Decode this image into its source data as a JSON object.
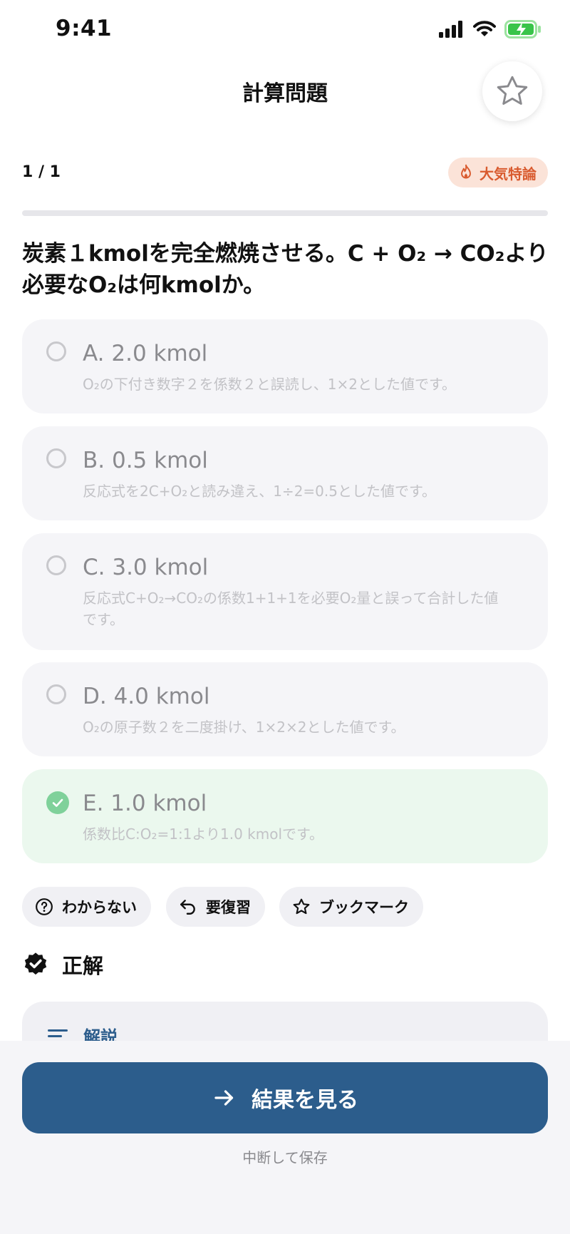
{
  "status_bar": {
    "time": "9:41"
  },
  "header": {
    "title": "計算問題"
  },
  "meta": {
    "counter": "1 / 1",
    "tag": "大気特論"
  },
  "question": {
    "text": "炭素１kmolを完全燃焼させる。C + O₂ → CO₂より必要なO₂は何kmolか。"
  },
  "choices": [
    {
      "label": "A. 2.0 kmol",
      "explanation": "O₂の下付き数字２を係数２と誤読し、1×2とした値です。",
      "state": "unselected"
    },
    {
      "label": "B. 0.5 kmol",
      "explanation": "反応式を2C+O₂と読み違え、1÷2=0.5とした値です。",
      "state": "unselected"
    },
    {
      "label": "C. 3.0 kmol",
      "explanation": "反応式C+O₂→CO₂の係数1+1+1を必要O₂量と誤って合計した値です。",
      "state": "unselected"
    },
    {
      "label": "D. 4.0 kmol",
      "explanation": "O₂の原子数２を二度掛け、1×2×2とした値です。",
      "state": "unselected"
    },
    {
      "label": "E. 1.0 kmol",
      "explanation": "係数比C:O₂=1:1より1.0 kmolです。",
      "state": "correct"
    }
  ],
  "actions": {
    "dont_know": "わからない",
    "review": "要復習",
    "bookmark": "ブックマーク"
  },
  "result": {
    "label": "正解"
  },
  "explanation": {
    "heading": "解説"
  },
  "footer": {
    "cta": "結果を見る",
    "save": "中断して保存"
  },
  "colors": {
    "primary": "#2c5d8c",
    "tag_bg": "#fbe3d8",
    "tag_text": "#d95b2f",
    "correct_bg": "#ebf8ee",
    "correct_check": "#7fd19a"
  }
}
